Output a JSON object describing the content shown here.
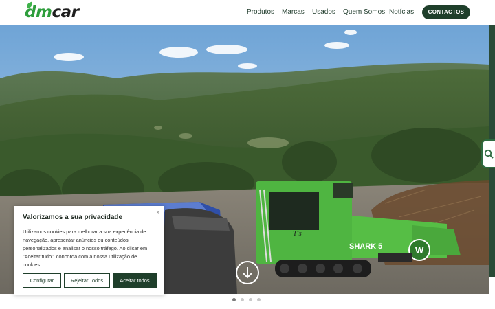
{
  "header": {
    "logo": {
      "part1": "dm",
      "part2": "car"
    },
    "nav": [
      "Produtos",
      "Marcas",
      "Usados",
      "Quem Somos",
      "Notícias"
    ],
    "contact_label": "CONTACTOS"
  },
  "hero": {
    "machine_brand": "SHARK 5",
    "machine_badge": "W"
  },
  "carousel": {
    "slides": 4,
    "active": 0
  },
  "cookie": {
    "title": "Valorizamos a sua privacidade",
    "body": "Utilizamos cookies para melhorar a sua experiência de navegação, apresentar anúncios ou conteúdos personalizados e analisar o nosso tráfego. Ao clicar em \"Aceitar tudo\", concorda com a nossa utilização de cookies.",
    "close_symbol": "×",
    "buttons": {
      "configure": "Configurar",
      "reject": "Rejeitar Todos",
      "accept": "Aceitar todos"
    }
  },
  "colors": {
    "brand_green": "#2e9e3c",
    "dark_green": "#1f3f2b",
    "machine_green": "#4fb541"
  },
  "icons": [
    "search-icon",
    "arrow-down-icon",
    "close-icon"
  ]
}
